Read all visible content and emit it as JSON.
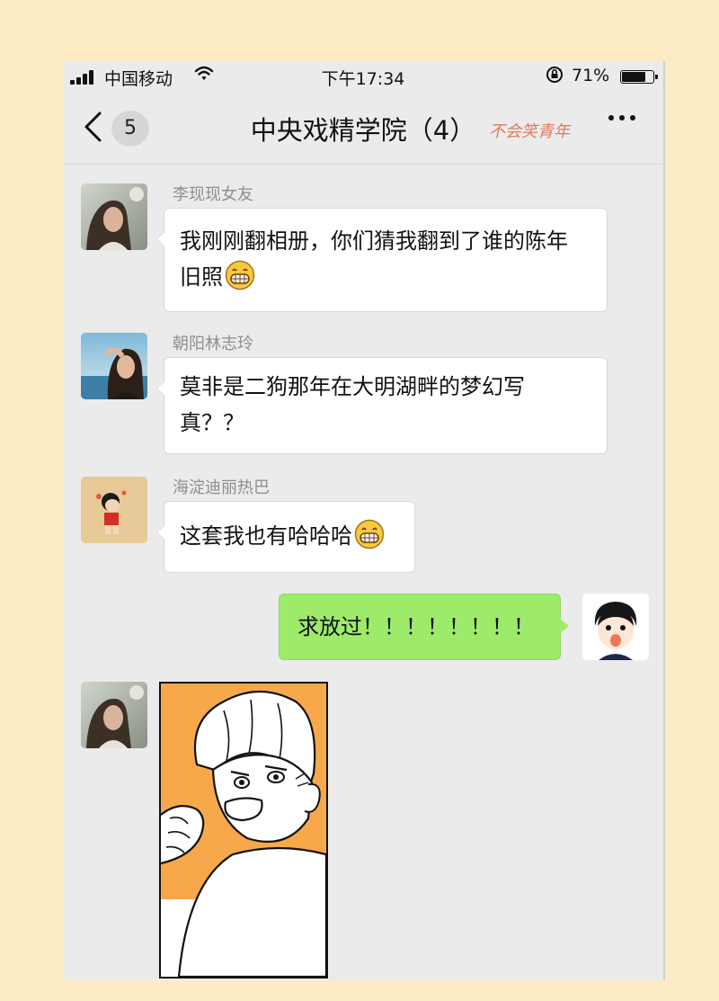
{
  "status_bar": {
    "carrier": "中国移动",
    "time": "下午17:34",
    "battery_percent": "71%",
    "battery_level": 0.71
  },
  "nav": {
    "back_badge_count": "5",
    "title": "中央戏精学院（4）",
    "watermark": "不会笑青年",
    "more_label": "···"
  },
  "messages": [
    {
      "sender": "李现现女友",
      "lines": [
        "我刚刚翻相册，你们猜我翻到了谁的陈年",
        "旧照"
      ],
      "emoji": "grin-emoji"
    },
    {
      "sender": "朝阳林志玲",
      "lines": [
        "莫非是二狗那年在大明湖畔的梦幻写",
        "真？？"
      ]
    },
    {
      "sender": "海淀迪丽热巴",
      "lines": [
        "这套我也有哈哈哈"
      ],
      "emoji": "grin-emoji"
    },
    {
      "sender": "",
      "lines": [
        "求放过！！！！！！！！"
      ],
      "outgoing": true
    },
    {
      "sender": "",
      "type": "image",
      "image": "comic-sticker"
    }
  ],
  "colors": {
    "page_bg": "#fdebc5",
    "chat_bg": "#ebebeb",
    "outgoing_bubble": "#9eea6a",
    "comic_accent": "#f7a84a"
  }
}
